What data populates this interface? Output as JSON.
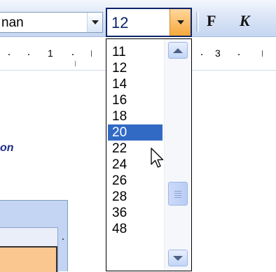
{
  "toolbar": {
    "font_name_partial": "nan",
    "font_size_value": "12",
    "bold_label": "F",
    "italic_label": "K"
  },
  "ruler": {
    "labels": [
      "1",
      "3"
    ]
  },
  "document": {
    "partial_text": "on"
  },
  "size_list": {
    "items": [
      "11",
      "12",
      "14",
      "16",
      "18",
      "20",
      "22",
      "24",
      "26",
      "28",
      "36",
      "48"
    ],
    "selected": "20"
  },
  "icons": {
    "combo_arrow": "chevron-down-icon",
    "scroll_up": "chevron-up-icon",
    "scroll_down": "chevron-down-icon",
    "cursor": "mouse-pointer-icon"
  },
  "colors": {
    "selection": "#316ac5",
    "toolbar_bg": "#d6e2f6",
    "accent_orange": "#f6a83c"
  }
}
